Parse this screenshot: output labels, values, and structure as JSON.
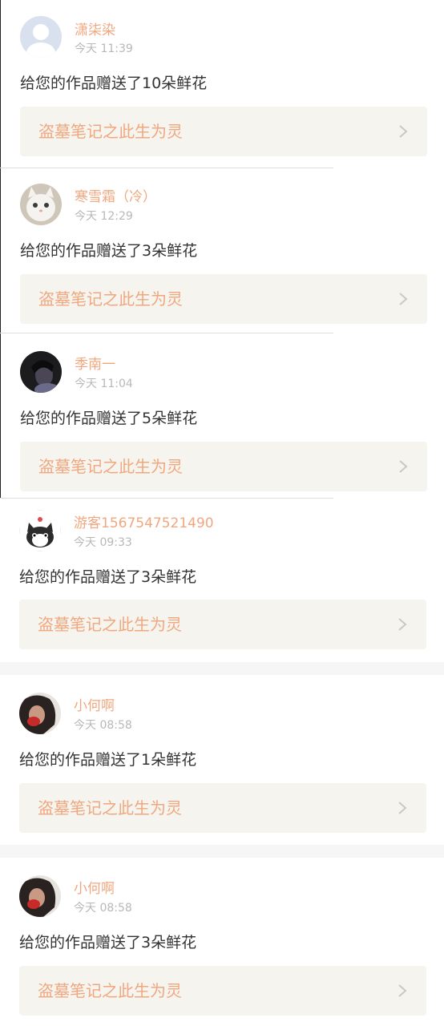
{
  "notifications": [
    {
      "user": "潇柒染",
      "time": "今天 11:39",
      "message": "给您的作品赠送了10朵鲜花",
      "work_title": "盗墓笔记之此生为灵",
      "avatar_icon": "default-avatar-icon"
    },
    {
      "user": "寒雪霜（冷）",
      "time": "今天 12:29",
      "message": "给您的作品赠送了3朵鲜花",
      "work_title": "盗墓笔记之此生为灵",
      "avatar_icon": "white-cat-avatar-icon"
    },
    {
      "user": "季南一",
      "time": "今天 11:04",
      "message": "给您的作品赠送了5朵鲜花",
      "work_title": "盗墓笔记之此生为灵",
      "avatar_icon": "dark-portrait-avatar-icon"
    },
    {
      "user": "游客1567547521490",
      "time": "今天 09:33",
      "message": "给您的作品赠送了3朵鲜花",
      "work_title": "盗墓笔记之此生为灵",
      "avatar_icon": "cartoon-cat-avatar-icon"
    },
    {
      "user": "小何啊",
      "time": "今天 08:58",
      "message": "给您的作品赠送了1朵鲜花",
      "work_title": "盗墓笔记之此生为灵",
      "avatar_icon": "photo-avatar-icon"
    },
    {
      "user": "小何啊",
      "time": "今天 08:58",
      "message": "给您的作品赠送了3朵鲜花",
      "work_title": "盗墓笔记之此生为灵",
      "avatar_icon": "photo-avatar-icon"
    }
  ],
  "colors": {
    "accent": "#f0a77f",
    "text": "#333333",
    "muted": "#b8b8b8",
    "link_bg": "#f6f4ee"
  }
}
